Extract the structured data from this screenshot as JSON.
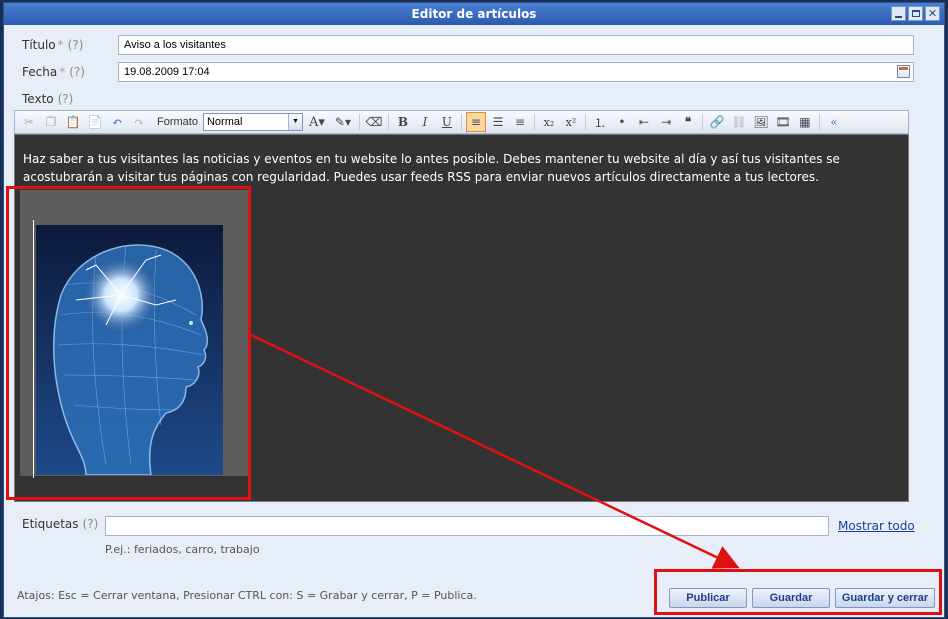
{
  "window": {
    "title": "Editor de artículos"
  },
  "form": {
    "title_label": "Título",
    "title_required": "*",
    "title_help": "(?)",
    "title_value": "Aviso a los visitantes",
    "date_label": "Fecha",
    "date_required": "*",
    "date_help": "(?)",
    "date_value": "19.08.2009 17:04",
    "text_label": "Texto",
    "text_help": "(?)"
  },
  "toolbar": {
    "format_label": "Formato",
    "format_value": "Normal",
    "icons": [
      "cut-icon",
      "copy-icon",
      "paste-icon",
      "paste-text-icon",
      "undo-icon",
      "redo-icon",
      "font-color-icon",
      "background-color-icon",
      "remove-format-icon",
      "bold-icon",
      "italic-icon",
      "underline-icon",
      "align-left-icon",
      "align-center-icon",
      "align-right-icon",
      "subscript-icon",
      "superscript-icon",
      "numbered-list-icon",
      "bulleted-list-icon",
      "outdent-icon",
      "indent-icon",
      "blockquote-icon",
      "link-icon",
      "unlink-icon",
      "image-icon",
      "flash-icon",
      "table-icon"
    ]
  },
  "editor": {
    "body_text": "Haz saber a tus visitantes las noticias y eventos en tu website lo antes posible. Debes mantener tu website al día y así tus visitantes se acostubrarán a visitar tus páginas con regularidad. Puedes usar feeds RSS para enviar nuevos artículos directamente a tus lectores."
  },
  "tags": {
    "label": "Etiquetas",
    "help": "(?)",
    "value": "",
    "show_all": "Mostrar todo",
    "example": "P.ej.: feriados, carro, trabajo"
  },
  "footer": {
    "shortcuts": "Atajos: Esc = Cerrar ventana, Presionar CTRL con: S = Grabar y cerrar, P = Publica.",
    "publish_label": "Publicar",
    "save_label": "Guardar",
    "save_close_label": "Guardar y cerrar"
  },
  "colors": {
    "accent": "#2a5bb0",
    "highlight": "#e01010",
    "editor_bg": "#333333"
  }
}
